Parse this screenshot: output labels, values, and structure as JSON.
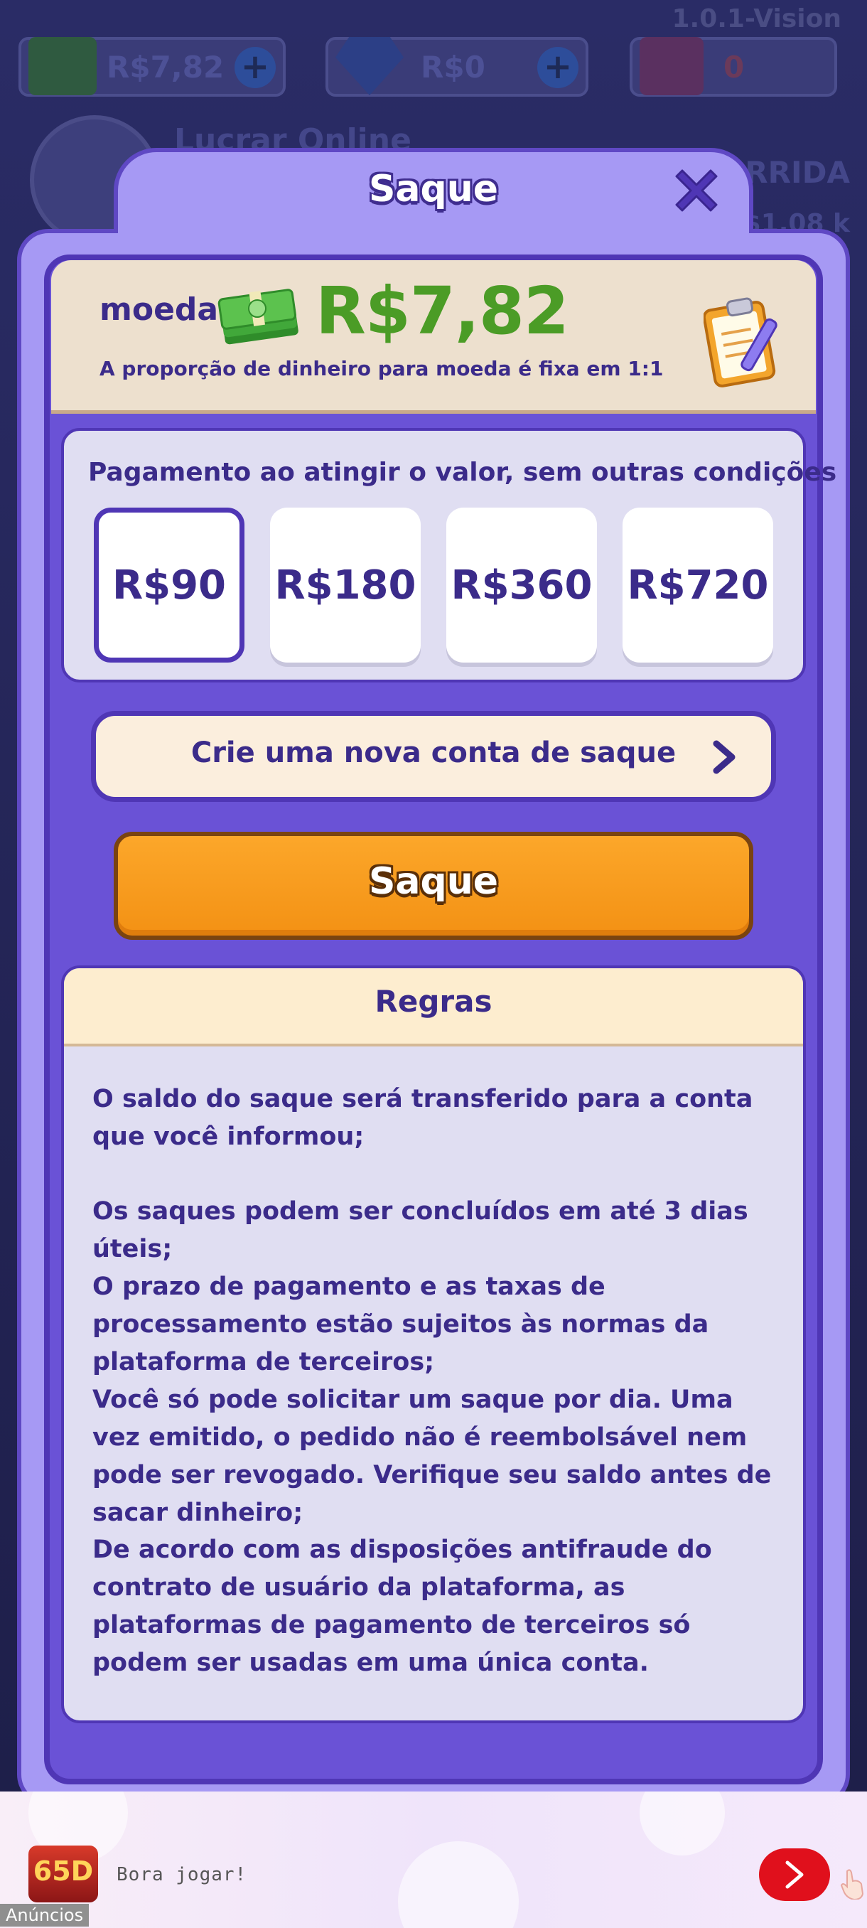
{
  "background": {
    "version": "1.0.1-Vision",
    "balance_cash": "R$7,82",
    "balance_diamond": "R$0",
    "vip_count": "0",
    "player_name": "Lucrar Online",
    "right_label": "CORRIDA",
    "right_value": "R$1,08 k"
  },
  "modal": {
    "title": "Saque",
    "close_icon": "close-icon"
  },
  "balance": {
    "label": "moeda",
    "value": "R$7,82",
    "ratio_text": "A proporção de dinheiro para moeda é fixa em 1:1",
    "currency_icon": "cash-stack-icon",
    "history_icon": "clipboard-icon"
  },
  "amounts": {
    "caption": "Pagamento ao atingir o valor, sem outras condições",
    "options": [
      "R$90",
      "R$180",
      "R$360",
      "R$720"
    ],
    "selected_index": 0
  },
  "account": {
    "label": "Crie uma nova conta de saque"
  },
  "withdraw_button": {
    "label": "Saque"
  },
  "rules": {
    "title": "Regras",
    "items": [
      "O saldo do saque será transferido para a conta que você informou;",
      "Os saques podem ser concluídos em até 3 dias úteis;",
      "O prazo de pagamento e as taxas de processamento estão sujeitos às normas da plataforma de terceiros;",
      "Você só pode solicitar um saque por dia. Uma vez emitido, o pedido não é reembolsável nem pode ser revogado. Verifique seu saldo antes de sacar dinheiro;",
      "De acordo com as disposições antifraude do contrato de usuário da plataforma, as plataformas de pagamento de terceiros só podem ser usadas em uma única conta."
    ]
  },
  "ad": {
    "logo_text": "65D",
    "text": "Bora jogar!",
    "badge": "Anúncios"
  },
  "colors": {
    "accent": "#6a52d6",
    "border": "#4f36b5",
    "text": "#3b2b8a",
    "money": "#4b9c26",
    "button": "#f39114"
  }
}
